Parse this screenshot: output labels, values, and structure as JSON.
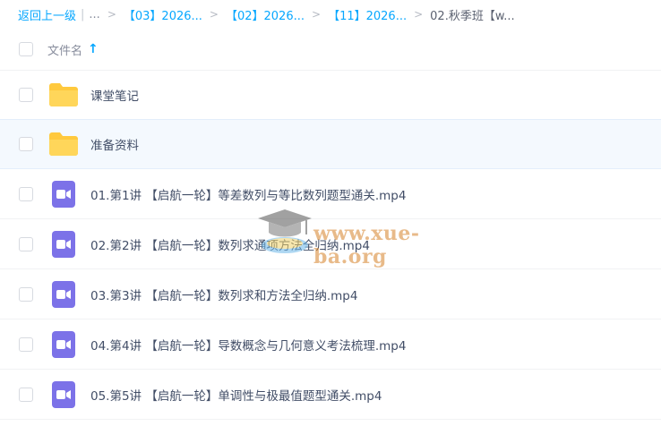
{
  "breadcrumb": {
    "back_label": "返回上一级",
    "pipe": "|",
    "ellipsis": "...",
    "separator": ">",
    "crumbs": [
      "【03】2026...",
      "【02】2026...",
      "【11】2026..."
    ],
    "current": "02.秋季班【w..."
  },
  "header": {
    "column_title": "文件名",
    "sort_arrow": "↑"
  },
  "files": [
    {
      "name": "课堂笔记",
      "type": "folder"
    },
    {
      "name": "准备资料",
      "type": "folder"
    },
    {
      "name": "01.第1讲 【启航一轮】等差数列与等比数列题型通关.mp4",
      "type": "video"
    },
    {
      "name": "02.第2讲 【启航一轮】数列求通项方法全归纳.mp4",
      "type": "video"
    },
    {
      "name": "03.第3讲 【启航一轮】数列求和方法全归纳.mp4",
      "type": "video"
    },
    {
      "name": "04.第4讲 【启航一轮】导数概念与几何意义考法梳理.mp4",
      "type": "video"
    },
    {
      "name": "05.第5讲 【启航一轮】单调性与极最值题型通关.mp4",
      "type": "video"
    }
  ],
  "watermark": {
    "text": "www.xue-ba.org"
  },
  "colors": {
    "accent": "#06a7ff",
    "folder": "#ffd65a",
    "video": "#7c72e8",
    "hover_row": "#f4f9fe"
  }
}
